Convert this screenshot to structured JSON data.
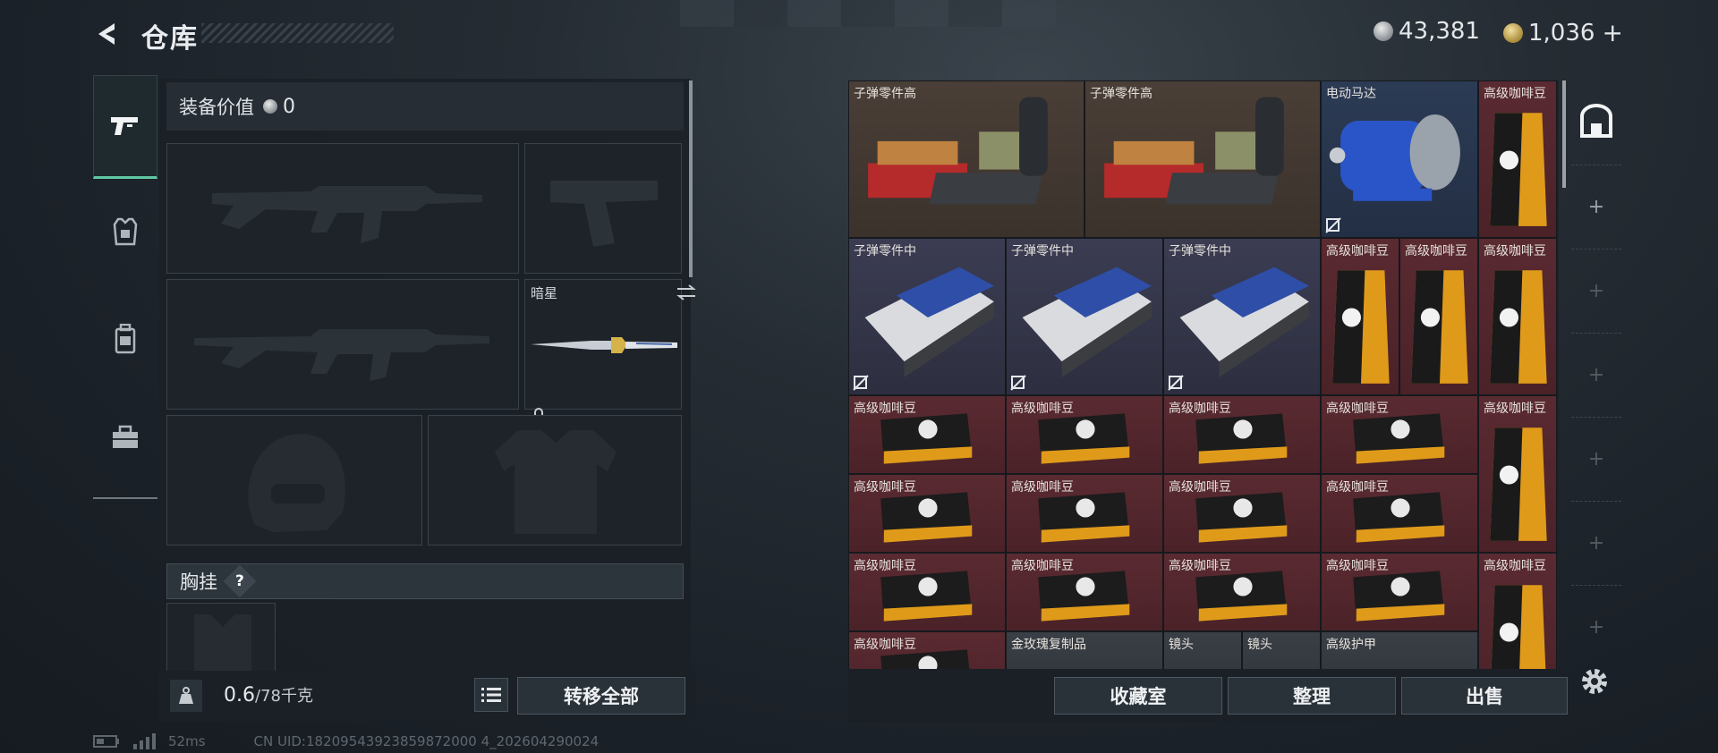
{
  "header": {
    "title": "仓库",
    "silver": "43,381",
    "gold": "1,036",
    "gold_add": "+"
  },
  "left_tabs": [
    {
      "name": "weapon",
      "active": true
    },
    {
      "name": "armor",
      "active": false
    },
    {
      "name": "backpack",
      "active": false
    },
    {
      "name": "case",
      "active": false
    }
  ],
  "loadout": {
    "value_label": "装备价值",
    "value": "0",
    "melee_slot_label": "暗星",
    "chest_label": "胸挂",
    "help": "?",
    "weight_value": "0.6",
    "weight_capacity": "/78千克",
    "transfer_all": "转移全部"
  },
  "inventory": {
    "items": [
      {
        "label": "子弹零件高",
        "col": 0,
        "row": 0,
        "w": 3,
        "h": 2,
        "color": "brown",
        "icon": "ammo-parts-high-crate"
      },
      {
        "label": "子弹零件高",
        "col": 3,
        "row": 0,
        "w": 3,
        "h": 2,
        "color": "brown",
        "icon": "ammo-parts-high-crate"
      },
      {
        "label": "电动马达",
        "col": 6,
        "row": 0,
        "w": 2,
        "h": 2,
        "color": "navy",
        "icon": "electric-motor",
        "unbound": true
      },
      {
        "label": "高级咖啡豆",
        "col": 8,
        "row": 0,
        "w": 1,
        "h": 2,
        "color": "red",
        "icon": "coffee-bag"
      },
      {
        "label": "子弹零件中",
        "col": 0,
        "row": 2,
        "w": 2,
        "h": 2,
        "color": "blue",
        "icon": "ammo-parts-mid-tray",
        "unbound": true
      },
      {
        "label": "子弹零件中",
        "col": 2,
        "row": 2,
        "w": 2,
        "h": 2,
        "color": "blue",
        "icon": "ammo-parts-mid-tray",
        "unbound": true
      },
      {
        "label": "子弹零件中",
        "col": 4,
        "row": 2,
        "w": 2,
        "h": 2,
        "color": "blue",
        "icon": "ammo-parts-mid-tray",
        "unbound": true
      },
      {
        "label": "高级咖啡豆",
        "col": 6,
        "row": 2,
        "w": 1,
        "h": 2,
        "color": "red",
        "icon": "coffee-bag"
      },
      {
        "label": "高级咖啡豆",
        "col": 7,
        "row": 2,
        "w": 1,
        "h": 2,
        "color": "red",
        "icon": "coffee-bag"
      },
      {
        "label": "高级咖啡豆",
        "col": 8,
        "row": 2,
        "w": 1,
        "h": 2,
        "color": "red",
        "icon": "coffee-bag"
      },
      {
        "label": "高级咖啡豆",
        "col": 0,
        "row": 4,
        "w": 2,
        "h": 1,
        "color": "red",
        "icon": "coffee-pack"
      },
      {
        "label": "高级咖啡豆",
        "col": 2,
        "row": 4,
        "w": 2,
        "h": 1,
        "color": "red",
        "icon": "coffee-pack"
      },
      {
        "label": "高级咖啡豆",
        "col": 4,
        "row": 4,
        "w": 2,
        "h": 1,
        "color": "red",
        "icon": "coffee-pack"
      },
      {
        "label": "高级咖啡豆",
        "col": 6,
        "row": 4,
        "w": 2,
        "h": 1,
        "color": "red",
        "icon": "coffee-pack"
      },
      {
        "label": "高级咖啡豆",
        "col": 8,
        "row": 4,
        "w": 1,
        "h": 2,
        "color": "red",
        "icon": "coffee-bag"
      },
      {
        "label": "高级咖啡豆",
        "col": 0,
        "row": 5,
        "w": 2,
        "h": 1,
        "color": "red",
        "icon": "coffee-pack"
      },
      {
        "label": "高级咖啡豆",
        "col": 2,
        "row": 5,
        "w": 2,
        "h": 1,
        "color": "red",
        "icon": "coffee-pack"
      },
      {
        "label": "高级咖啡豆",
        "col": 4,
        "row": 5,
        "w": 2,
        "h": 1,
        "color": "red",
        "icon": "coffee-pack"
      },
      {
        "label": "高级咖啡豆",
        "col": 6,
        "row": 5,
        "w": 2,
        "h": 1,
        "color": "red",
        "icon": "coffee-pack"
      },
      {
        "label": "高级咖啡豆",
        "col": 0,
        "row": 6,
        "w": 2,
        "h": 1,
        "color": "red",
        "icon": "coffee-pack"
      },
      {
        "label": "高级咖啡豆",
        "col": 2,
        "row": 6,
        "w": 2,
        "h": 1,
        "color": "red",
        "icon": "coffee-pack"
      },
      {
        "label": "高级咖啡豆",
        "col": 4,
        "row": 6,
        "w": 2,
        "h": 1,
        "color": "red",
        "icon": "coffee-pack"
      },
      {
        "label": "高级咖啡豆",
        "col": 6,
        "row": 6,
        "w": 2,
        "h": 1,
        "color": "red",
        "icon": "coffee-pack"
      },
      {
        "label": "高级咖啡豆",
        "col": 8,
        "row": 6,
        "w": 1,
        "h": 2,
        "color": "red",
        "icon": "coffee-bag"
      },
      {
        "label": "高级咖啡豆",
        "col": 0,
        "row": 7,
        "w": 2,
        "h": 1,
        "color": "red",
        "icon": "coffee-pack"
      },
      {
        "label": "金玫瑰复制品",
        "col": 2,
        "row": 7,
        "w": 2,
        "h": 1,
        "color": "gray",
        "icon": "golden-rose-replica"
      },
      {
        "label": "镜头",
        "col": 4,
        "row": 7,
        "w": 1,
        "h": 1,
        "color": "gray",
        "icon": "lens"
      },
      {
        "label": "镜头",
        "col": 5,
        "row": 7,
        "w": 1,
        "h": 1,
        "color": "gray",
        "icon": "lens"
      },
      {
        "label": "高级护甲",
        "col": 6,
        "row": 7,
        "w": 2,
        "h": 1,
        "color": "gray",
        "icon": "advanced-armor"
      }
    ]
  },
  "actions": {
    "collection_room": "收藏室",
    "sort": "整理",
    "sell": "出售"
  },
  "status": {
    "ping": "52ms",
    "uid": "CN UID:18209543923859872000 4_202604290024"
  }
}
